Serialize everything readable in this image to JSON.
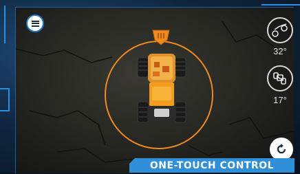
{
  "controls": {
    "menu": {
      "icon": "hamburger-menu-icon"
    },
    "tilt_front": {
      "icon": "front-tilt-truck-icon",
      "value": "32°"
    },
    "tilt_side": {
      "icon": "side-tilt-truck-icon",
      "value": "17°"
    },
    "reset": {
      "icon": "reset-rotate-icon"
    },
    "steering": {
      "ring_color": "#f08a21",
      "tab_color": "#f08a21"
    }
  },
  "banner": {
    "label": "ONE-TOUCH CONTROL"
  },
  "colors": {
    "accent": "#2f8fd8",
    "ring": "#f08a21",
    "frame": "#2a8fe0"
  }
}
